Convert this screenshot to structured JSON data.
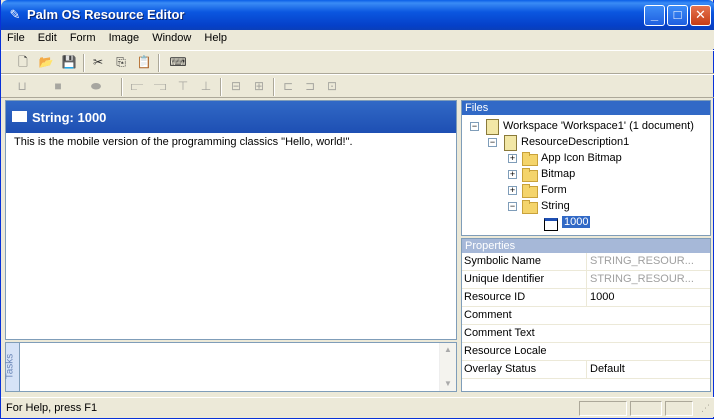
{
  "window": {
    "title": "Palm OS Resource Editor",
    "app_icon": "palm-stylus-icon",
    "buttons": {
      "minimize": "_",
      "maximize": "□",
      "close": "✕"
    }
  },
  "menu": [
    "File",
    "Edit",
    "Form",
    "Image",
    "Window",
    "Help"
  ],
  "toolbar1": [
    {
      "name": "new-icon",
      "glyph": "🗋"
    },
    {
      "name": "open-icon",
      "glyph": "📂"
    },
    {
      "name": "save-icon",
      "glyph": "💾"
    },
    {
      "name": "cut-icon",
      "glyph": "✂"
    },
    {
      "name": "copy-icon",
      "glyph": "⎘"
    },
    {
      "name": "paste-icon",
      "glyph": "📋"
    },
    {
      "name": "device-icon",
      "glyph": "⌨"
    }
  ],
  "editor": {
    "title": "String: 1000",
    "content": "This is the mobile version of the programming classics \"Hello, world!\"."
  },
  "tasks": {
    "tab_label": "Tasks"
  },
  "files": {
    "header": "Files",
    "workspace": "Workspace 'Workspace1' (1 document)",
    "document": "ResourceDescription1",
    "folders": [
      "App Icon Bitmap",
      "Bitmap",
      "Form",
      "String"
    ],
    "selected_item": "1000",
    "expand": "+",
    "collapse": "−"
  },
  "properties": {
    "header": "Properties",
    "rows": [
      {
        "key": "Symbolic Name",
        "value": "STRING_RESOUR...",
        "muted": true
      },
      {
        "key": "Unique Identifier",
        "value": "STRING_RESOUR...",
        "muted": true
      },
      {
        "key": "Resource ID",
        "value": "1000",
        "muted": false
      },
      {
        "key": "Comment",
        "value": "",
        "muted": false
      },
      {
        "key": "Comment Text",
        "value": "",
        "muted": false
      },
      {
        "key": "Resource Locale",
        "value": "",
        "muted": false
      },
      {
        "key": "Overlay Status",
        "value": "Default",
        "muted": false
      }
    ]
  },
  "status": {
    "message": "For Help, press F1"
  }
}
